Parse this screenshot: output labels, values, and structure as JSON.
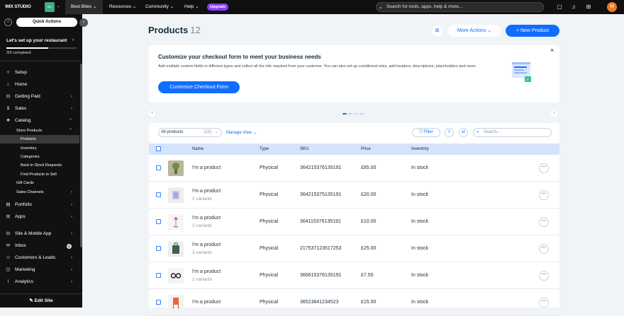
{
  "topbar": {
    "logo": "WIX STUDIO",
    "site_initials": "MC",
    "tabs": [
      "Best Bites",
      "Resources",
      "Community",
      "Help"
    ],
    "upgrade": "Upgrade",
    "search_placeholder": "Search for tools, apps, help & more...",
    "avatar_initial": "H",
    "icons": [
      "chat-icon",
      "bell-icon",
      "grid-icon"
    ]
  },
  "sidebar": {
    "quick_actions": "Quick Actions",
    "setup_title": "Let's set up your restaurant",
    "progress": 0.6,
    "completed": "3/5 completed",
    "items": [
      {
        "label": "Setup",
        "icon": "wand"
      },
      {
        "label": "Home",
        "icon": "home"
      },
      {
        "label": "Getting Paid",
        "icon": "paid",
        "chevron": true
      },
      {
        "label": "Sales",
        "icon": "sales",
        "chevron": true
      },
      {
        "label": "Catalog",
        "icon": "catalog",
        "chevron": "up"
      },
      {
        "label": "Store Products",
        "sub": true,
        "chevron": "up"
      },
      {
        "label": "Products",
        "sub2": true,
        "selected": true
      },
      {
        "label": "Inventory",
        "sub2": true
      },
      {
        "label": "Categories",
        "sub2": true
      },
      {
        "label": "Back in Stock Requests",
        "sub2": true
      },
      {
        "label": "Find Products to Sell",
        "sub2": true
      },
      {
        "label": "Gift Cards",
        "sub": true
      },
      {
        "label": "Sales Channels",
        "sub": true,
        "chevron": true
      },
      {
        "label": "Portfolio",
        "icon": "portfolio",
        "chevron": true
      },
      {
        "label": "Apps",
        "icon": "apps",
        "chevron": true
      },
      {
        "label": "Site & Mobile App",
        "icon": "site",
        "chevron": true
      },
      {
        "label": "Inbox",
        "icon": "inbox",
        "badge": "1"
      },
      {
        "label": "Customers & Leads",
        "icon": "customers",
        "chevron": true
      },
      {
        "label": "Marketing",
        "icon": "marketing",
        "chevron": true
      },
      {
        "label": "Analytics",
        "icon": "analytics",
        "chevron": true
      }
    ],
    "edit_site": "Edit Site"
  },
  "page": {
    "title": "Products",
    "count": "12",
    "more_actions": "More Actions",
    "new_product": "+ New Product"
  },
  "banner": {
    "title": "Customize your checkout form to meet your business needs",
    "desc": "Add multiple custom fields in different types and collect all the info required from your customer. You can also set up conditional rules, add headers, descriptions, placeholders and more.",
    "button": "Customize Checkout Form",
    "close": "×"
  },
  "filters": {
    "view": "All products",
    "view_count": "(12)",
    "manage_view": "Manage View",
    "filter": "Filter",
    "search_placeholder": "Search..."
  },
  "table": {
    "columns": [
      "Name",
      "Type",
      "SKU",
      "Price",
      "Inventory"
    ],
    "rows": [
      {
        "name": "I'm a product",
        "variants": "",
        "type": "Physical",
        "sku": "364215376135191",
        "price": "£85.00",
        "inventory": "In stock",
        "thumb": "plant"
      },
      {
        "name": "I'm a product",
        "variants": "2 variants",
        "type": "Physical",
        "sku": "364215375135191",
        "price": "£20.00",
        "inventory": "In stock",
        "thumb": "box"
      },
      {
        "name": "I'm a product",
        "variants": "2 variants",
        "type": "Physical",
        "sku": "364115376135191",
        "price": "£10.00",
        "inventory": "In stock",
        "thumb": "lamp"
      },
      {
        "name": "I'm a product",
        "variants": "3 variants",
        "type": "Physical",
        "sku": "217537123517253",
        "price": "£25.00",
        "inventory": "In stock",
        "thumb": "bag"
      },
      {
        "name": "I'm a product",
        "variants": "2 variants",
        "type": "Physical",
        "sku": "366615376135191",
        "price": "£7.50",
        "inventory": "In stock",
        "thumb": "glasses"
      },
      {
        "name": "I'm a product",
        "variants": "",
        "type": "Physical",
        "sku": "36523641234523",
        "price": "£15.00",
        "inventory": "In stock",
        "thumb": "chair"
      }
    ]
  }
}
